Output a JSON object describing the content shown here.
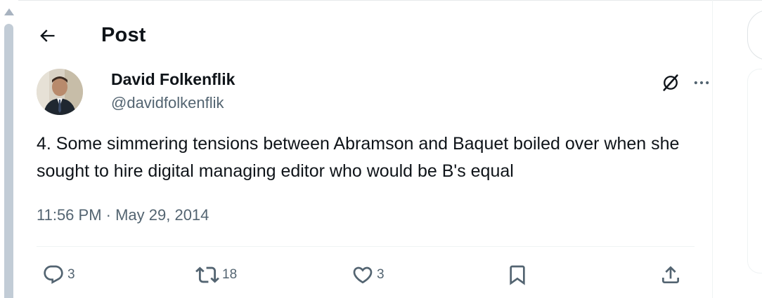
{
  "header": {
    "title": "Post",
    "back_icon": "arrow-left-icon"
  },
  "post": {
    "author_name": "David Folkenflik",
    "author_handle": "@davidfolkenflik",
    "text": "4. Some simmering tensions between Abramson and Baquet boiled over when she sought to hire digital managing editor who would be B's equal",
    "timestamp": "11:56 PM · May 29, 2014",
    "grok_icon": "grok-icon",
    "more_icon": "more-horizontal-icon"
  },
  "actions": {
    "reply_count": "3",
    "repost_count": "18",
    "like_count": "3",
    "bookmark_count": "",
    "share_count": ""
  },
  "colors": {
    "text_primary": "#0f1419",
    "text_secondary": "#536471",
    "divider": "#eff3f4",
    "scrollbar": "#c2ccd6"
  }
}
